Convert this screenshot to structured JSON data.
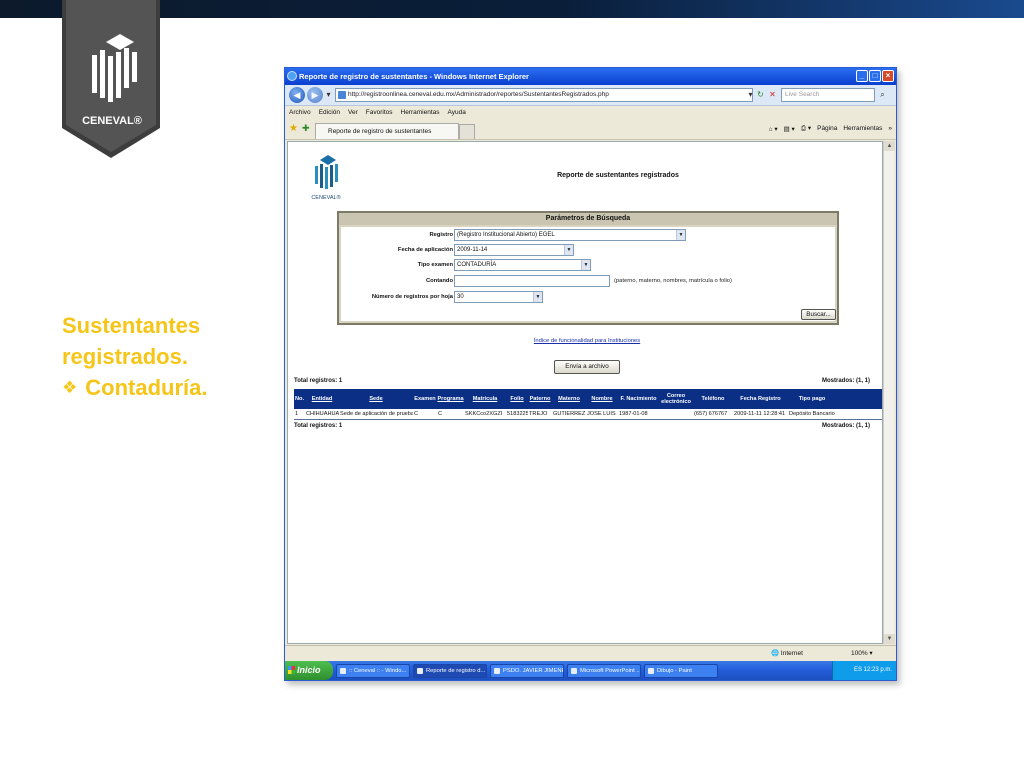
{
  "slide": {
    "brand": "CENEVAL",
    "brand_mark": "®",
    "title_line1": "Sustentantes",
    "title_line2": "registrados.",
    "bullet_text": "Contaduría."
  },
  "browser": {
    "window_title": "Reporte de registro de sustentantes - Windows Internet Explorer",
    "url": "http://registroonlinea.ceneval.edu.mx/Administrador/reportes/SustentantesRegistrados.php",
    "search_placeholder": "Live Search",
    "menu": [
      "Archivo",
      "Edición",
      "Ver",
      "Favoritos",
      "Herramientas",
      "Ayuda"
    ],
    "tab_label": "Reporte de registro de sustentantes",
    "tools": {
      "page": "Página",
      "tools": "Herramientas"
    },
    "status": {
      "zone": "Internet",
      "zoom": "100%"
    }
  },
  "report": {
    "logo_text": "CENEVAL®",
    "title": "Reporte de sustentantes registrados",
    "params_title": "Parámetros de Búsqueda",
    "fields": {
      "registro_label": "Registro",
      "registro_value": "(Registro Institucional Abierto) EGEL",
      "fecha_label": "Fecha de aplicación",
      "fecha_value": "2009-11-14",
      "tipo_label": "Tipo examen",
      "tipo_value": "CONTADURÍA",
      "contando_label": "Contando",
      "contando_value": "",
      "contando_hint": "(paterno, materno, nombres, matrícula o folio)",
      "numero_label": "Número de registros por hoja",
      "numero_value": "30"
    },
    "search_button": "Buscar...",
    "index_link": "Índice de funcionalidad para Instituciones",
    "send_button": "Envía a archivo",
    "total_top": "Total registros: 1",
    "shown_top": "Mostrados: (1, 1)",
    "total_bottom": "Total registros: 1",
    "shown_bottom": "Mostrados: (1, 1)",
    "columns": [
      "No.",
      "Entidad",
      "Sede",
      "Examen",
      "Programa",
      "Matrícula",
      "Folio",
      "Paterno",
      "Materno",
      "Nombre",
      "F. Nacimiento",
      "Correo electrónico",
      "Teléfono",
      "Fecha Registro",
      "Tipo pago"
    ],
    "rows": [
      [
        "1",
        "CHIHUAHUA",
        "Sede de aplicación de prueba 1",
        "C",
        "C",
        "SKKCco2XGZI",
        "518322593",
        "TREJO",
        "GUTIERREZ",
        "JOSE LUIS",
        "1987-01-08",
        "",
        "(657) 676767",
        "2009-11-11 12:28:41",
        "Depósito Bancario"
      ]
    ]
  },
  "taskbar": {
    "start": "Inicio",
    "items": [
      ":: Ceneval :: - Windo...",
      "Reporte de registro d...",
      "PSDO. JAVIER JIMENE...",
      "Microsoft PowerPoint ...",
      "Dibujo - Paint"
    ],
    "clock": "12:23 p.m.",
    "tray_text": "ES"
  },
  "colors": {
    "title_yellow": "#f5c518",
    "grid_header": "#0a2f85",
    "badge_gray": "#4a4a4a"
  }
}
